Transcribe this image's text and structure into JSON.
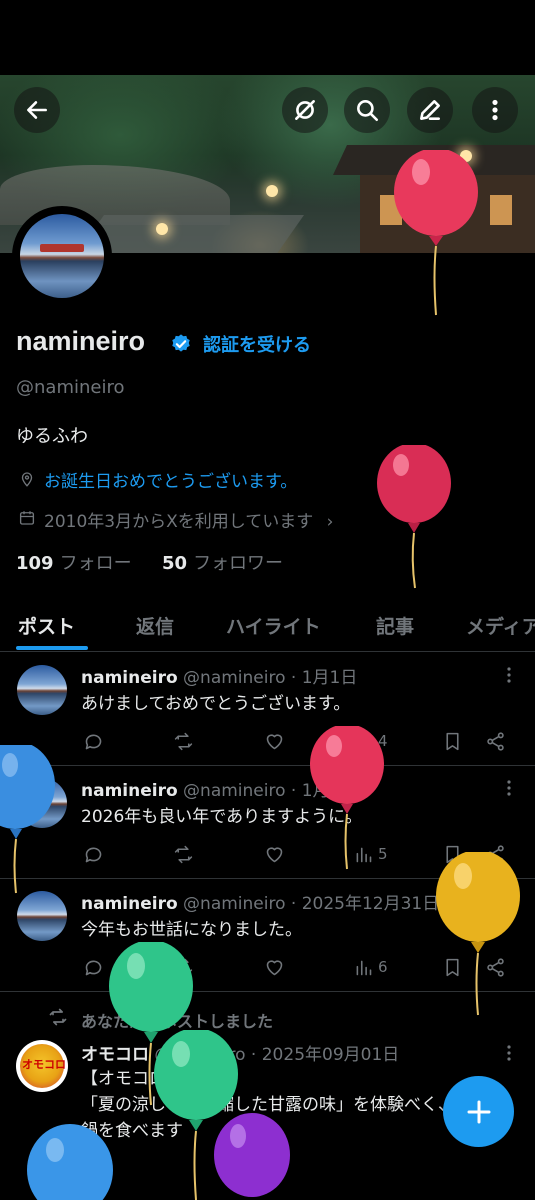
{
  "header": {
    "back_icon": "arrow-left-icon",
    "grok_icon": "grok-icon",
    "search_icon": "search-icon",
    "edit_icon": "edit-icon",
    "more_icon": "more-vertical-icon"
  },
  "profile": {
    "display_name": "namineiro",
    "verify_link": "認証を受ける",
    "handle": "@namineiro",
    "bio": "ゆるふわ",
    "birthday": "お誕生日おめでとうございます。",
    "joined": "2010年3月からXを利用しています",
    "following_count": "109",
    "following_label": "フォロー",
    "followers_count": "50",
    "followers_label": "フォロワー"
  },
  "tabs": [
    "ポスト",
    "返信",
    "ハイライト",
    "記事",
    "メディア"
  ],
  "posts": [
    {
      "name": "namineiro",
      "meta": "@namineiro · 1月1日",
      "text": "あけましておめでとうございます。",
      "views": "4"
    },
    {
      "name": "namineiro",
      "meta": "@namineiro · 1月1日",
      "text": "2026年も良い年でありますように。",
      "views": "5"
    },
    {
      "name": "namineiro",
      "meta": "@namineiro · 2025年12月31日",
      "text": "今年もお世話になりました。",
      "views": "6"
    }
  ],
  "repost": {
    "label": "あなたがリポストしました",
    "name": "オモコロ",
    "meta": "@omocoro · 2025年09月01日",
    "avatar_text": "オモコロ",
    "text": "【オモコロブロス】\n「夏の涼しさを濃縮した甘露の味」を体験べく、真夏に鍋を食べます"
  },
  "fab_icon": "plus-icon",
  "colors": {
    "accent": "#1d9bf0",
    "muted": "#71767b",
    "text": "#e7e9ea"
  }
}
